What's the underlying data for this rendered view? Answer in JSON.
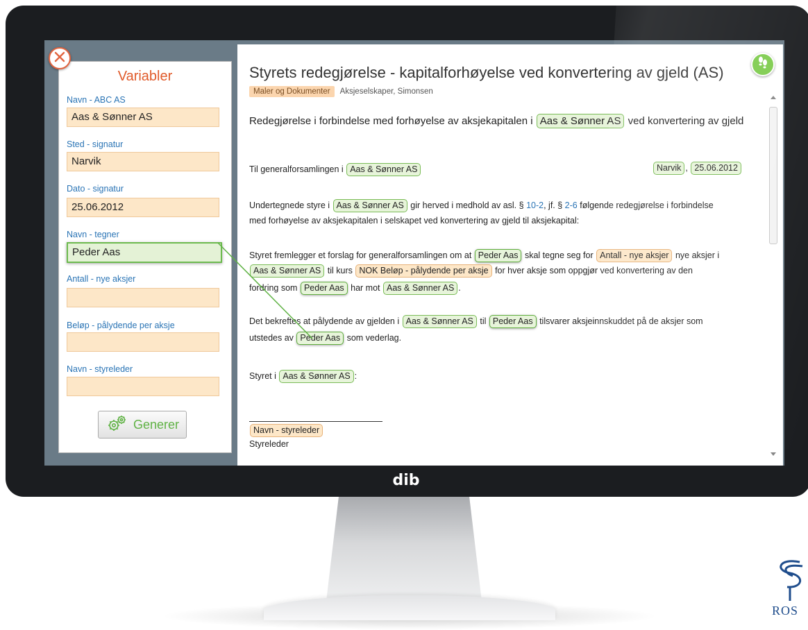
{
  "panel": {
    "title": "Variabler",
    "fields": [
      {
        "label": "Navn - ABC AS",
        "value": "Aas & Sønner AS"
      },
      {
        "label": "Sted - signatur",
        "value": "Narvik"
      },
      {
        "label": "Dato - signatur",
        "value": "25.06.2012"
      },
      {
        "label": "Navn - tegner",
        "value": "Peder Aas"
      },
      {
        "label": "Antall - nye aksjer",
        "value": ""
      },
      {
        "label": "Beløp - pålydende per aksje",
        "value": ""
      },
      {
        "label": "Navn - styreleder",
        "value": ""
      }
    ],
    "generate_label": "Generer"
  },
  "doc": {
    "title": "Styrets redegjørelse - kapitalforhøyelse ved konvertering av gjeld (AS)",
    "category": "Maler og Dokumenter",
    "tags": "Aksjeselskaper,  Simonsen",
    "heading_text": "Redegjørelse i forbindelse med forhøyelse av aksjekapitalen i",
    "heading_company": "Aas & Sønner AS",
    "heading_tail": "ved konvertering av gjeld",
    "to_text": "Til generalforsamlingen i",
    "to_company": "Aas & Sønner AS",
    "place": "Narvik",
    "comma": ",",
    "date": "25.06.2012",
    "p1a": "Undertegnede styre i",
    "p1_company": "Aas & Sønner AS",
    "p1b": "gir herved i medhold av asl. §",
    "p1_ref1": "10-2",
    "p1c": ", jf. §",
    "p1_ref2": "2-6",
    "p1d": "følgende redegjørelse i forbindelse",
    "p1e": "med forhøyelse av aksjekapitalen i selskapet ved konvertering av gjeld til aksjekapital:",
    "p2a": "Styret fremlegger et forslag for generalforsamlingen om at",
    "p2_person1": "Peder Aas",
    "p2b": "skal tegne seg for",
    "p2_antall": "Antall - nye aksjer",
    "p2c": "nye aksjer i",
    "p2_company1": "Aas & Sønner AS",
    "p2d": "til kurs",
    "p2_belop": "NOK Beløp - pålydende per aksje",
    "p2e": "for hver aksje som oppgjør ved konvertering av den",
    "p2f": "fordring som",
    "p2_person2": "Peder Aas",
    "p2g": "har mot",
    "p2_company2": "Aas & Sønner AS",
    "p2h": ".",
    "p3a": "Det bekreftes at pålydende av gjelden i",
    "p3_company": "Aas & Sønner AS",
    "p3b": "til",
    "p3_person1": "Peder Aas",
    "p3c": "tilsvarer aksjeinnskuddet på de aksjer som",
    "p3d": "utstedes av",
    "p3_person2": "Peder Aas",
    "p3e": "som vederlag.",
    "p4a": "Styret i",
    "p4_company": "Aas & Sønner AS",
    "p4b": ":",
    "sig_name": "Navn - styreleder",
    "sig_role": "Styreleder"
  },
  "monitor_brand": "dib",
  "corner_logo_text": "ROS",
  "colors": {
    "accent_orange": "#e05a2a",
    "label_blue": "#2a74b5",
    "green": "#6cba4e",
    "input_fill": "#fde7c8"
  },
  "icons": {
    "close": "close-icon",
    "help": "footsteps-icon",
    "generate": "gears-icon"
  }
}
